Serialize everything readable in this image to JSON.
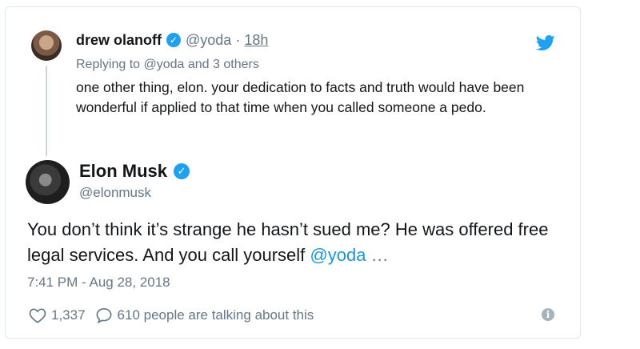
{
  "reply": {
    "name": "drew olanoff",
    "handle": "@yoda",
    "separator": "·",
    "time": "18h",
    "replying_to": "Replying to @yoda and 3 others",
    "text": "one other thing, elon. your dedication to facts and truth would have been wonderful if applied to that time when you called someone a pedo."
  },
  "tweet": {
    "name": "Elon Musk",
    "handle": "@elonmusk",
    "text_before": "You don’t think it’s strange he hasn’t sued me? He was offered free legal services. And you call yourself ",
    "mention": "@yoda",
    "ellipsis": " …",
    "timestamp": "7:41 PM - Aug 28, 2018",
    "likes": "1,337",
    "talking": "610 people are talking about this"
  },
  "icons": {
    "verified": "verified-badge-icon",
    "bird": "twitter-bird-icon",
    "heart": "heart-icon",
    "reply_bubble": "comment-bubble-icon",
    "info": "info-icon"
  },
  "colors": {
    "brand_blue": "#1da1f2",
    "link_blue": "#1b95e0",
    "muted": "#657786",
    "border": "#e1e8ed"
  }
}
